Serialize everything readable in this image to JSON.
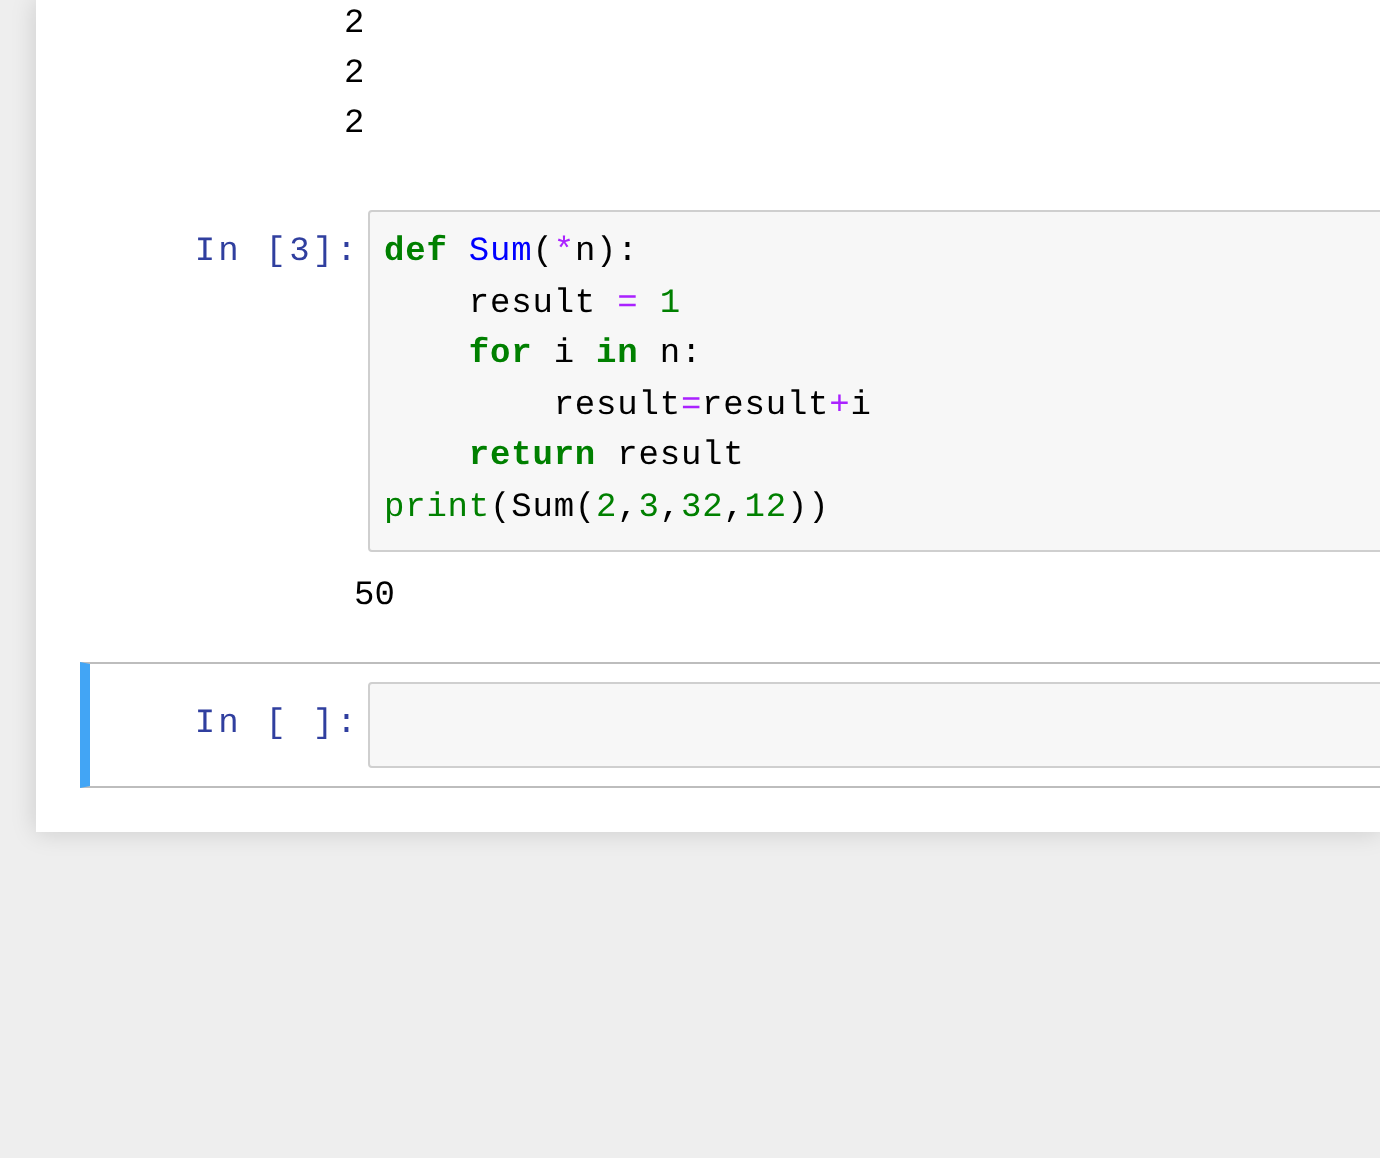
{
  "cells": [
    {
      "kind": "output",
      "outputs": [
        "2",
        "2",
        "2"
      ]
    },
    {
      "kind": "code",
      "prompt": "In [3]:",
      "selected": false,
      "lines": [
        [
          {
            "kind": "keyword",
            "text": "def"
          },
          {
            "kind": "function",
            "text": " Sum"
          },
          {
            "kind": "plain",
            "text": "("
          },
          {
            "kind": "operator",
            "text": "*"
          },
          {
            "kind": "plain",
            "text": "n):"
          }
        ],
        [
          {
            "kind": "plain",
            "text": "    result "
          },
          {
            "kind": "operator",
            "text": "="
          },
          {
            "kind": "number",
            "text": " 1"
          }
        ],
        [
          {
            "kind": "keyword",
            "text": "    for"
          },
          {
            "kind": "plain",
            "text": " i "
          },
          {
            "kind": "keyword",
            "text": "in"
          },
          {
            "kind": "plain",
            "text": " n:"
          }
        ],
        [
          {
            "kind": "plain",
            "text": "        result"
          },
          {
            "kind": "operator",
            "text": "="
          },
          {
            "kind": "plain",
            "text": "result"
          },
          {
            "kind": "operator",
            "text": "+"
          },
          {
            "kind": "plain",
            "text": "i"
          }
        ],
        [
          {
            "kind": "keyword",
            "text": "    return"
          },
          {
            "kind": "plain",
            "text": " result"
          }
        ],
        [
          {
            "kind": "builtin",
            "text": "print"
          },
          {
            "kind": "plain",
            "text": "(Sum("
          },
          {
            "kind": "number",
            "text": "2"
          },
          {
            "kind": "plain",
            "text": ","
          },
          {
            "kind": "number",
            "text": "3"
          },
          {
            "kind": "plain",
            "text": ","
          },
          {
            "kind": "number",
            "text": "32"
          },
          {
            "kind": "plain",
            "text": ","
          },
          {
            "kind": "number",
            "text": "12"
          },
          {
            "kind": "plain",
            "text": "))"
          }
        ]
      ],
      "outputs": [
        "50"
      ]
    },
    {
      "kind": "code",
      "prompt": "In [ ]:",
      "selected": true
    }
  ]
}
